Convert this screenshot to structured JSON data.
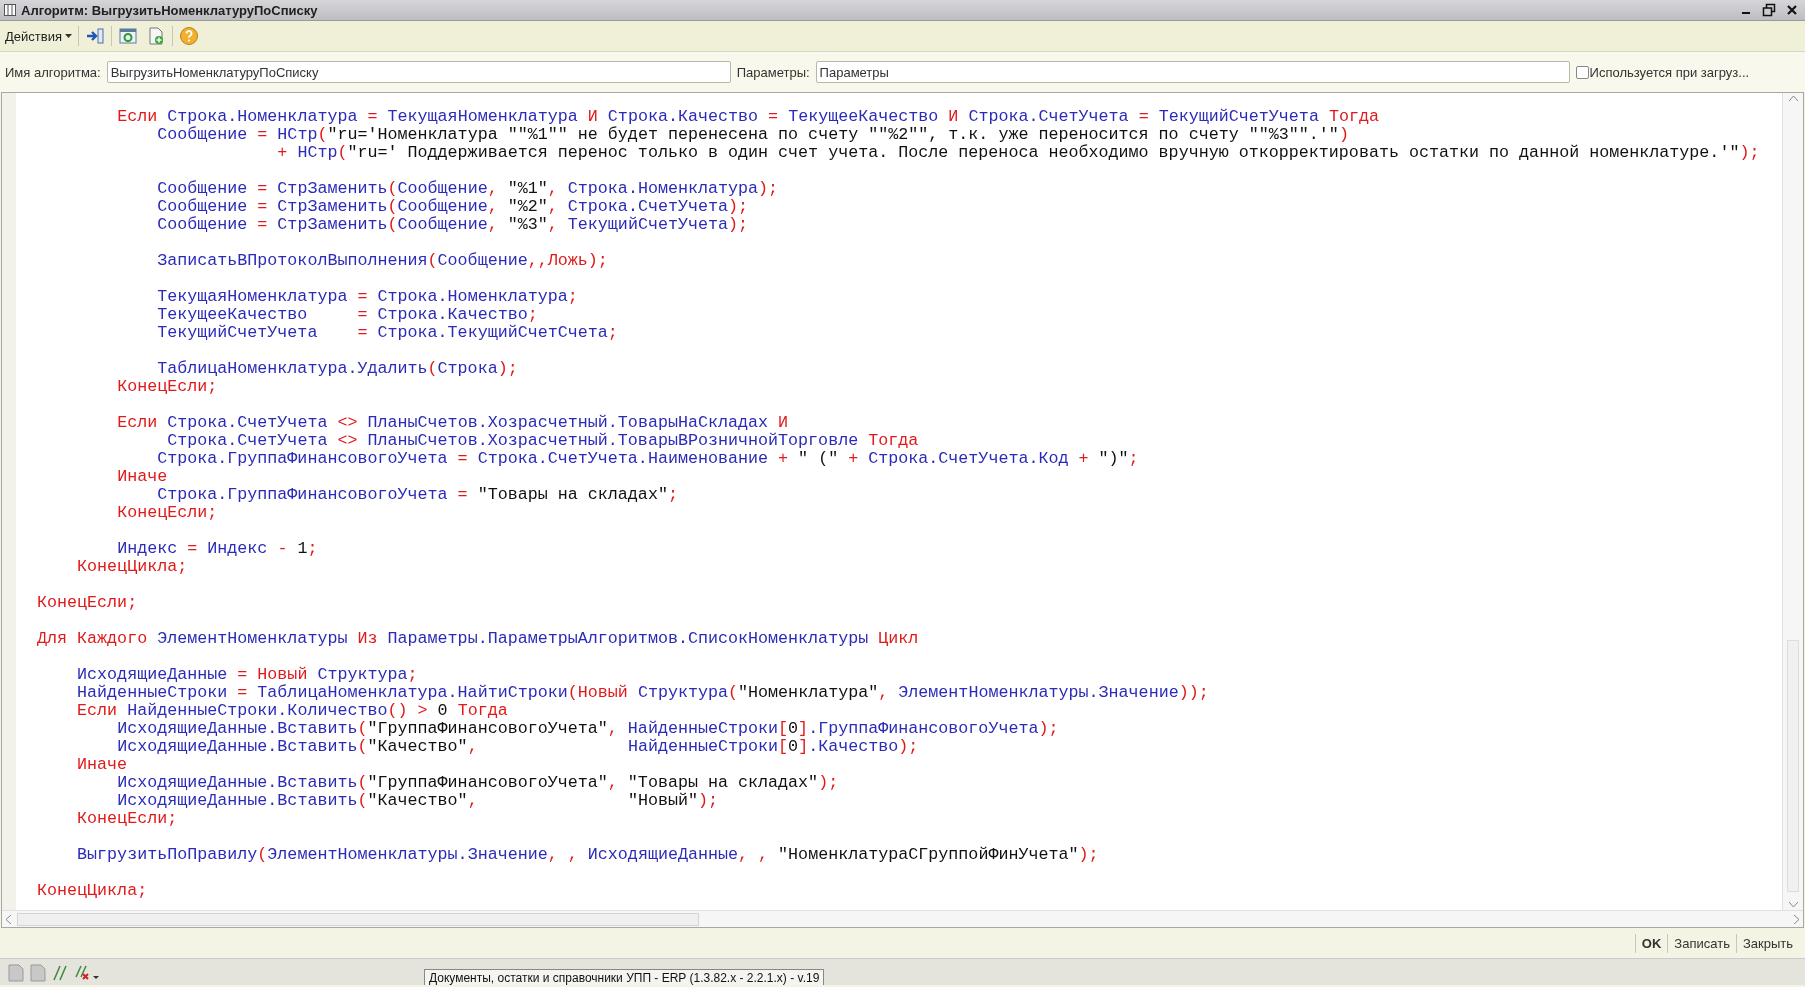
{
  "window": {
    "title": "Алгоритм: ВыгрузитьНоменклатуруПоСписку"
  },
  "toolbar": {
    "actions_menu": "Действия"
  },
  "form": {
    "name_label": "Имя алгоритма:",
    "name_value": "ВыгрузитьНоменклатуруПоСписку",
    "params_label": "Параметры:",
    "params_value": "Параметры",
    "used_on_import": {
      "label": "Используется при загруз...",
      "checked": false
    }
  },
  "code": {
    "lines": [
      {
        "kind": "code",
        "segs": [
          {
            "kind": "keyword",
            "text": "\t\tЕсли "
          },
          {
            "kind": "name",
            "text": "Строка.Номенклатура "
          },
          {
            "kind": "keyword",
            "text": "= "
          },
          {
            "kind": "name",
            "text": "ТекущаяНоменклатура "
          },
          {
            "kind": "keyword",
            "text": "И "
          },
          {
            "kind": "name",
            "text": "Строка.Качество "
          },
          {
            "kind": "keyword",
            "text": "= "
          },
          {
            "kind": "name",
            "text": "ТекущееКачество "
          },
          {
            "kind": "keyword",
            "text": "И "
          },
          {
            "kind": "name",
            "text": "Строка.СчетУчета "
          },
          {
            "kind": "keyword",
            "text": "= "
          },
          {
            "kind": "name",
            "text": "ТекущийСчетУчета "
          },
          {
            "kind": "keyword",
            "text": "Тогда"
          }
        ]
      },
      {
        "kind": "code",
        "segs": [
          {
            "kind": "name",
            "text": "\t\t\tСообщение "
          },
          {
            "kind": "keyword",
            "text": "= "
          },
          {
            "kind": "name",
            "text": "НСтр"
          },
          {
            "kind": "keyword",
            "text": "("
          },
          {
            "kind": "literal",
            "text": "\"ru='Номенклатура \"\"%1\"\" не будет перенесена по счету \"\"%2\"\", т.к. уже переносится по счету \"\"%3\"\".'\""
          },
          {
            "kind": "keyword",
            "text": ")"
          }
        ]
      },
      {
        "kind": "code",
        "segs": [
          {
            "kind": "keyword",
            "text": "\t\t\t\t\t\t+ "
          },
          {
            "kind": "name",
            "text": "НСтр"
          },
          {
            "kind": "keyword",
            "text": "("
          },
          {
            "kind": "literal",
            "text": "\"ru=' Поддерживается перенос только в один счет учета. После переноса необходимо вручную откорректировать остатки по данной номенклатуре.'\""
          },
          {
            "kind": "keyword",
            "text": ");"
          }
        ]
      },
      {
        "kind": "blank"
      },
      {
        "kind": "code",
        "segs": [
          {
            "kind": "name",
            "text": "\t\t\tСообщение "
          },
          {
            "kind": "keyword",
            "text": "= "
          },
          {
            "kind": "name",
            "text": "СтрЗаменить"
          },
          {
            "kind": "keyword",
            "text": "("
          },
          {
            "kind": "name",
            "text": "Сообщение"
          },
          {
            "kind": "keyword",
            "text": ", "
          },
          {
            "kind": "literal",
            "text": "\"%1\""
          },
          {
            "kind": "keyword",
            "text": ", "
          },
          {
            "kind": "name",
            "text": "Строка.Номенклатура"
          },
          {
            "kind": "keyword",
            "text": ");"
          }
        ]
      },
      {
        "kind": "code",
        "segs": [
          {
            "kind": "name",
            "text": "\t\t\tСообщение "
          },
          {
            "kind": "keyword",
            "text": "= "
          },
          {
            "kind": "name",
            "text": "СтрЗаменить"
          },
          {
            "kind": "keyword",
            "text": "("
          },
          {
            "kind": "name",
            "text": "Сообщение"
          },
          {
            "kind": "keyword",
            "text": ", "
          },
          {
            "kind": "literal",
            "text": "\"%2\""
          },
          {
            "kind": "keyword",
            "text": ", "
          },
          {
            "kind": "name",
            "text": "Строка.СчетУчета"
          },
          {
            "kind": "keyword",
            "text": ");"
          }
        ]
      },
      {
        "kind": "code",
        "segs": [
          {
            "kind": "name",
            "text": "\t\t\tСообщение "
          },
          {
            "kind": "keyword",
            "text": "= "
          },
          {
            "kind": "name",
            "text": "СтрЗаменить"
          },
          {
            "kind": "keyword",
            "text": "("
          },
          {
            "kind": "name",
            "text": "Сообщение"
          },
          {
            "kind": "keyword",
            "text": ", "
          },
          {
            "kind": "literal",
            "text": "\"%3\""
          },
          {
            "kind": "keyword",
            "text": ", "
          },
          {
            "kind": "name",
            "text": "ТекущийСчетУчета"
          },
          {
            "kind": "keyword",
            "text": ");"
          }
        ]
      },
      {
        "kind": "blank"
      },
      {
        "kind": "code",
        "segs": [
          {
            "kind": "name",
            "text": "\t\t\tЗаписатьВПротоколВыполнения"
          },
          {
            "kind": "keyword",
            "text": "("
          },
          {
            "kind": "name",
            "text": "Сообщение"
          },
          {
            "kind": "keyword",
            "text": ",,Ложь);"
          }
        ]
      },
      {
        "kind": "blank"
      },
      {
        "kind": "code",
        "segs": [
          {
            "kind": "name",
            "text": "\t\t\tТекущаяНоменклатура "
          },
          {
            "kind": "keyword",
            "text": "= "
          },
          {
            "kind": "name",
            "text": "Строка.Номенклатура"
          },
          {
            "kind": "keyword",
            "text": ";"
          }
        ]
      },
      {
        "kind": "code",
        "segs": [
          {
            "kind": "name",
            "text": "\t\t\tТекущееКачество     "
          },
          {
            "kind": "keyword",
            "text": "= "
          },
          {
            "kind": "name",
            "text": "Строка.Качество"
          },
          {
            "kind": "keyword",
            "text": ";"
          }
        ]
      },
      {
        "kind": "code",
        "segs": [
          {
            "kind": "name",
            "text": "\t\t\tТекущийСчетУчета    "
          },
          {
            "kind": "keyword",
            "text": "= "
          },
          {
            "kind": "name",
            "text": "Строка.ТекущийСчетСчета"
          },
          {
            "kind": "keyword",
            "text": ";"
          }
        ]
      },
      {
        "kind": "blank"
      },
      {
        "kind": "code",
        "segs": [
          {
            "kind": "name",
            "text": "\t\t\tТаблицаНоменклатура.Удалить"
          },
          {
            "kind": "keyword",
            "text": "("
          },
          {
            "kind": "name",
            "text": "Строка"
          },
          {
            "kind": "keyword",
            "text": ");"
          }
        ]
      },
      {
        "kind": "code",
        "segs": [
          {
            "kind": "keyword",
            "text": "\t\tКонецЕсли;"
          }
        ]
      },
      {
        "kind": "blank"
      },
      {
        "kind": "code",
        "segs": [
          {
            "kind": "keyword",
            "text": "\t\tЕсли "
          },
          {
            "kind": "name",
            "text": "Строка.СчетУчета "
          },
          {
            "kind": "keyword",
            "text": "<> "
          },
          {
            "kind": "name",
            "text": "ПланыСчетов.Хозрасчетный.ТоварыНаСкладах "
          },
          {
            "kind": "keyword",
            "text": "И"
          }
        ]
      },
      {
        "kind": "code",
        "segs": [
          {
            "kind": "name",
            "text": "\t\t     Строка.СчетУчета "
          },
          {
            "kind": "keyword",
            "text": "<> "
          },
          {
            "kind": "name",
            "text": "ПланыСчетов.Хозрасчетный.ТоварыВРозничнойТорговле "
          },
          {
            "kind": "keyword",
            "text": "Тогда"
          }
        ]
      },
      {
        "kind": "code",
        "segs": [
          {
            "kind": "name",
            "text": "\t\t\tСтрока.ГруппаФинансовогоУчета "
          },
          {
            "kind": "keyword",
            "text": "= "
          },
          {
            "kind": "name",
            "text": "Строка.СчетУчета.Наименование "
          },
          {
            "kind": "keyword",
            "text": "+ "
          },
          {
            "kind": "literal",
            "text": "\" (\" "
          },
          {
            "kind": "keyword",
            "text": "+ "
          },
          {
            "kind": "name",
            "text": "Строка.СчетУчета.Код "
          },
          {
            "kind": "keyword",
            "text": "+ "
          },
          {
            "kind": "literal",
            "text": "\")\""
          },
          {
            "kind": "keyword",
            "text": ";"
          }
        ]
      },
      {
        "kind": "code",
        "segs": [
          {
            "kind": "keyword",
            "text": "\t\tИначе"
          }
        ]
      },
      {
        "kind": "code",
        "segs": [
          {
            "kind": "name",
            "text": "\t\t\tСтрока.ГруппаФинансовогоУчета "
          },
          {
            "kind": "keyword",
            "text": "= "
          },
          {
            "kind": "literal",
            "text": "\"Товары на складах\""
          },
          {
            "kind": "keyword",
            "text": ";"
          }
        ]
      },
      {
        "kind": "code",
        "segs": [
          {
            "kind": "keyword",
            "text": "\t\tКонецЕсли;"
          }
        ]
      },
      {
        "kind": "blank"
      },
      {
        "kind": "code",
        "segs": [
          {
            "kind": "name",
            "text": "\t\tИндекс "
          },
          {
            "kind": "keyword",
            "text": "= "
          },
          {
            "kind": "name",
            "text": "Индекс "
          },
          {
            "kind": "keyword",
            "text": "- "
          },
          {
            "kind": "literal",
            "text": "1"
          },
          {
            "kind": "keyword",
            "text": ";"
          }
        ]
      },
      {
        "kind": "code",
        "segs": [
          {
            "kind": "keyword",
            "text": "\tКонецЦикла;"
          }
        ]
      },
      {
        "kind": "blank"
      },
      {
        "kind": "code",
        "segs": [
          {
            "kind": "keyword",
            "text": "КонецЕсли;"
          }
        ]
      },
      {
        "kind": "blank"
      },
      {
        "kind": "code",
        "segs": [
          {
            "kind": "keyword",
            "text": "Для Каждого "
          },
          {
            "kind": "name",
            "text": "ЭлементНоменклатуры "
          },
          {
            "kind": "keyword",
            "text": "Из "
          },
          {
            "kind": "name",
            "text": "Параметры.ПараметрыАлгоритмов.СписокНоменклатуры "
          },
          {
            "kind": "keyword",
            "text": "Цикл"
          }
        ]
      },
      {
        "kind": "blank"
      },
      {
        "kind": "code",
        "segs": [
          {
            "kind": "name",
            "text": "\tИсходящиеДанные "
          },
          {
            "kind": "keyword",
            "text": "= Новый "
          },
          {
            "kind": "name",
            "text": "Структура"
          },
          {
            "kind": "keyword",
            "text": ";"
          }
        ]
      },
      {
        "kind": "code",
        "segs": [
          {
            "kind": "name",
            "text": "\tНайденныеСтроки "
          },
          {
            "kind": "keyword",
            "text": "= "
          },
          {
            "kind": "name",
            "text": "ТаблицаНоменклатура.НайтиСтроки"
          },
          {
            "kind": "keyword",
            "text": "(Новый "
          },
          {
            "kind": "name",
            "text": "Структура"
          },
          {
            "kind": "keyword",
            "text": "("
          },
          {
            "kind": "literal",
            "text": "\"Номенклатура\""
          },
          {
            "kind": "keyword",
            "text": ", "
          },
          {
            "kind": "name",
            "text": "ЭлементНоменклатуры.Значение"
          },
          {
            "kind": "keyword",
            "text": "));"
          }
        ]
      },
      {
        "kind": "code",
        "segs": [
          {
            "kind": "keyword",
            "text": "\tЕсли "
          },
          {
            "kind": "name",
            "text": "НайденныеСтроки.Количество"
          },
          {
            "kind": "keyword",
            "text": "() > "
          },
          {
            "kind": "literal",
            "text": "0 "
          },
          {
            "kind": "keyword",
            "text": "Тогда"
          }
        ]
      },
      {
        "kind": "code",
        "segs": [
          {
            "kind": "name",
            "text": "\t\tИсходящиеДанные.Вставить"
          },
          {
            "kind": "keyword",
            "text": "("
          },
          {
            "kind": "literal",
            "text": "\"ГруппаФинансовогоУчета\""
          },
          {
            "kind": "keyword",
            "text": ", "
          },
          {
            "kind": "name",
            "text": "НайденныеСтроки"
          },
          {
            "kind": "keyword",
            "text": "["
          },
          {
            "kind": "literal",
            "text": "0"
          },
          {
            "kind": "keyword",
            "text": "]"
          },
          {
            "kind": "name",
            "text": ".ГруппаФинансовогоУчета"
          },
          {
            "kind": "keyword",
            "text": ");"
          }
        ]
      },
      {
        "kind": "code",
        "segs": [
          {
            "kind": "name",
            "text": "\t\tИсходящиеДанные.Вставить"
          },
          {
            "kind": "keyword",
            "text": "("
          },
          {
            "kind": "literal",
            "text": "\"Качество\""
          },
          {
            "kind": "keyword",
            "text": ",               "
          },
          {
            "kind": "name",
            "text": "НайденныеСтроки"
          },
          {
            "kind": "keyword",
            "text": "["
          },
          {
            "kind": "literal",
            "text": "0"
          },
          {
            "kind": "keyword",
            "text": "]"
          },
          {
            "kind": "name",
            "text": ".Качество"
          },
          {
            "kind": "keyword",
            "text": ");"
          }
        ]
      },
      {
        "kind": "code",
        "segs": [
          {
            "kind": "keyword",
            "text": "\tИначе"
          }
        ]
      },
      {
        "kind": "code",
        "segs": [
          {
            "kind": "name",
            "text": "\t\tИсходящиеДанные.Вставить"
          },
          {
            "kind": "keyword",
            "text": "("
          },
          {
            "kind": "literal",
            "text": "\"ГруппаФинансовогоУчета\""
          },
          {
            "kind": "keyword",
            "text": ", "
          },
          {
            "kind": "literal",
            "text": "\"Товары на складах\""
          },
          {
            "kind": "keyword",
            "text": ");"
          }
        ]
      },
      {
        "kind": "code",
        "segs": [
          {
            "kind": "name",
            "text": "\t\tИсходящиеДанные.Вставить"
          },
          {
            "kind": "keyword",
            "text": "("
          },
          {
            "kind": "literal",
            "text": "\"Качество\""
          },
          {
            "kind": "keyword",
            "text": ",               "
          },
          {
            "kind": "literal",
            "text": "\"Новый\""
          },
          {
            "kind": "keyword",
            "text": ");"
          }
        ]
      },
      {
        "kind": "code",
        "segs": [
          {
            "kind": "keyword",
            "text": "\tКонецЕсли;"
          }
        ]
      },
      {
        "kind": "blank"
      },
      {
        "kind": "code",
        "segs": [
          {
            "kind": "name",
            "text": "\tВыгрузитьПоПравилу"
          },
          {
            "kind": "keyword",
            "text": "("
          },
          {
            "kind": "name",
            "text": "ЭлементНоменклатуры.Значение"
          },
          {
            "kind": "keyword",
            "text": ", , "
          },
          {
            "kind": "name",
            "text": "ИсходящиеДанные"
          },
          {
            "kind": "keyword",
            "text": ", , "
          },
          {
            "kind": "literal",
            "text": "\"НоменклатураСГруппойФинУчета\""
          },
          {
            "kind": "keyword",
            "text": ");"
          }
        ]
      },
      {
        "kind": "blank"
      },
      {
        "kind": "code",
        "segs": [
          {
            "kind": "keyword",
            "text": "КонецЦикла;"
          }
        ]
      }
    ]
  },
  "buttons": [
    {
      "label": "OK",
      "default": true
    },
    {
      "label": "Записать",
      "default": false
    },
    {
      "label": "Закрыть",
      "default": false
    }
  ],
  "taskbar": {
    "text": "Документы, остатки и справочники УПП - ERP (1.3.82.x - 2.2.1.x) - v.19"
  }
}
